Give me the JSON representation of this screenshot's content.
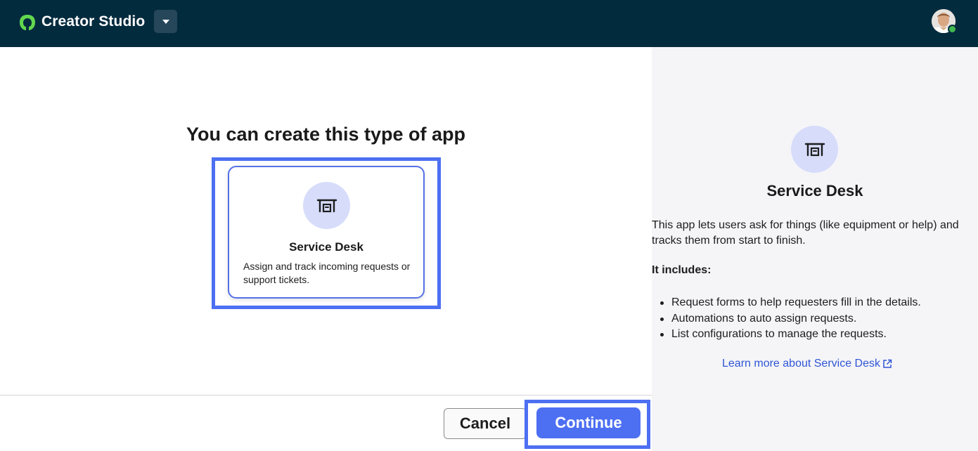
{
  "header": {
    "brand": "Creator Studio"
  },
  "main": {
    "title": "You can create this type of app",
    "card": {
      "title": "Service Desk",
      "description": "Assign and track incoming requests or support tickets."
    },
    "cancel_label": "Cancel",
    "continue_label": "Continue"
  },
  "side": {
    "title": "Service Desk",
    "description": "This app lets users ask for things (like equipment or help) and tracks them from start to finish.",
    "includes_label": "It includes:",
    "items": [
      "Request forms to help requesters fill in the details.",
      "Automations to auto assign requests.",
      "List configurations to manage the requests."
    ],
    "learn_more": "Learn more about Service Desk"
  },
  "colors": {
    "topbar": "#032b3e",
    "accent": "#4d6ff2",
    "icon_circle": "#d6dcfa",
    "side_bg": "#f5f5f8",
    "link": "#2f55d4"
  },
  "icons": {
    "logo": "creator-logo-icon",
    "caret": "caret-down-icon",
    "app": "service-desk-icon",
    "external": "external-link-icon"
  }
}
